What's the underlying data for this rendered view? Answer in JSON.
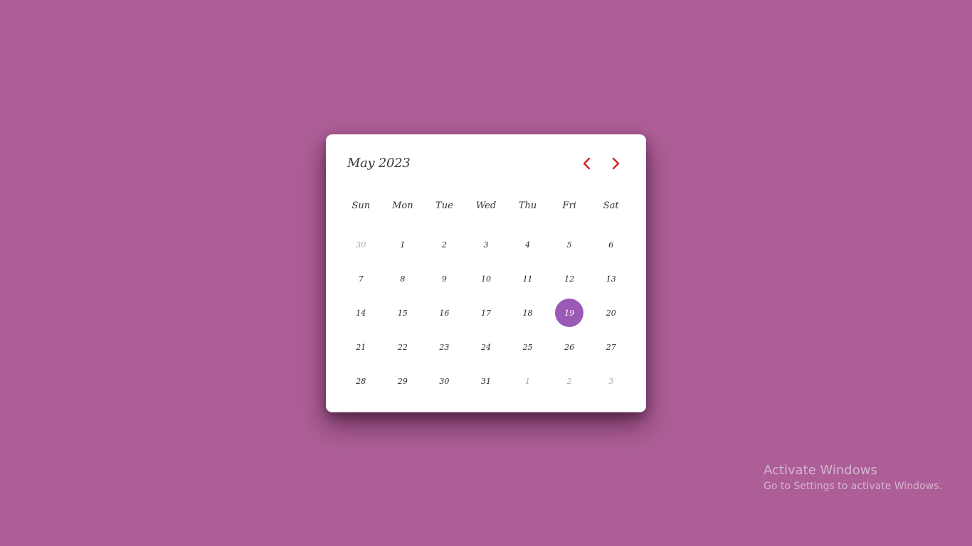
{
  "colors": {
    "background": "#ad5e96",
    "card": "#ffffff",
    "selected": "#9b59b6",
    "arrow": "#d81e1e"
  },
  "calendar": {
    "month_label": "May 2023",
    "prev_icon": "chevron-left-icon",
    "next_icon": "chevron-right-icon",
    "weekdays": [
      "Sun",
      "Mon",
      "Tue",
      "Wed",
      "Thu",
      "Fri",
      "Sat"
    ],
    "days": [
      {
        "label": "30",
        "other_month": true
      },
      {
        "label": "1"
      },
      {
        "label": "2"
      },
      {
        "label": "3"
      },
      {
        "label": "4"
      },
      {
        "label": "5"
      },
      {
        "label": "6"
      },
      {
        "label": "7"
      },
      {
        "label": "8"
      },
      {
        "label": "9"
      },
      {
        "label": "10"
      },
      {
        "label": "11"
      },
      {
        "label": "12"
      },
      {
        "label": "13"
      },
      {
        "label": "14"
      },
      {
        "label": "15"
      },
      {
        "label": "16"
      },
      {
        "label": "17"
      },
      {
        "label": "18"
      },
      {
        "label": "19",
        "selected": true
      },
      {
        "label": "20"
      },
      {
        "label": "21"
      },
      {
        "label": "22"
      },
      {
        "label": "23"
      },
      {
        "label": "24"
      },
      {
        "label": "25"
      },
      {
        "label": "26"
      },
      {
        "label": "27"
      },
      {
        "label": "28"
      },
      {
        "label": "29"
      },
      {
        "label": "30"
      },
      {
        "label": "31"
      },
      {
        "label": "1",
        "other_month": true
      },
      {
        "label": "2",
        "other_month": true
      },
      {
        "label": "3",
        "other_month": true
      }
    ]
  },
  "watermark": {
    "title": "Activate Windows",
    "subtitle": "Go to Settings to activate Windows."
  }
}
